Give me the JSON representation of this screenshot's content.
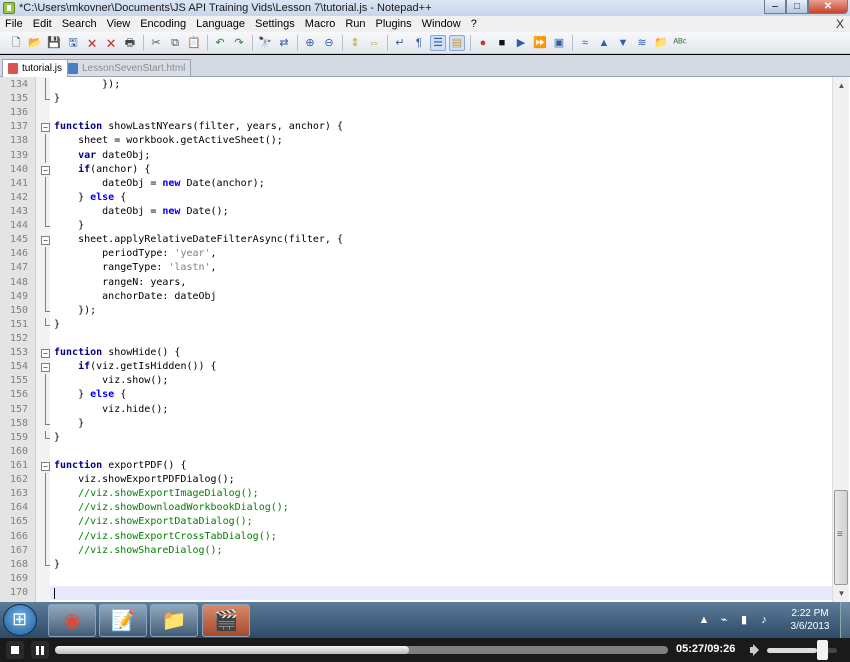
{
  "window": {
    "title": "*C:\\Users\\mkovner\\Documents\\JS API Training Vids\\Lesson 7\\tutorial.js - Notepad++",
    "minimize": "‒",
    "maximize": "□",
    "close": "✕"
  },
  "menu": [
    "File",
    "Edit",
    "Search",
    "View",
    "Encoding",
    "Language",
    "Settings",
    "Macro",
    "Run",
    "Plugins",
    "Window",
    "?"
  ],
  "menu_close": "X",
  "toolbar": [
    {
      "name": "new-file-icon",
      "glyph": "🗋",
      "color": "#333"
    },
    {
      "name": "open-file-icon",
      "glyph": "📂",
      "color": "#c89b2c"
    },
    {
      "name": "save-icon",
      "glyph": "💾",
      "color": "#2f5fa8"
    },
    {
      "name": "save-all-icon",
      "glyph": "🖫",
      "color": "#2f5fa8"
    },
    {
      "name": "close-file-icon",
      "glyph": "🗙",
      "color": "#c0392b"
    },
    {
      "name": "close-all-icon",
      "glyph": "🗙",
      "color": "#c0392b"
    },
    {
      "name": "print-icon",
      "glyph": "🖶",
      "color": "#444"
    },
    {
      "sep": true
    },
    {
      "name": "cut-icon",
      "glyph": "✂",
      "color": "#555"
    },
    {
      "name": "copy-icon",
      "glyph": "⧉",
      "color": "#555"
    },
    {
      "name": "paste-icon",
      "glyph": "📋",
      "color": "#a67c33"
    },
    {
      "sep": true
    },
    {
      "name": "undo-icon",
      "glyph": "↶",
      "color": "#2e7d32"
    },
    {
      "name": "redo-icon",
      "glyph": "↷",
      "color": "#2e7d32"
    },
    {
      "sep": true
    },
    {
      "name": "find-icon",
      "glyph": "🔭",
      "color": "#333"
    },
    {
      "name": "replace-icon",
      "glyph": "⇄",
      "color": "#2f5fa8"
    },
    {
      "sep": true
    },
    {
      "name": "zoom-in-icon",
      "glyph": "⊕",
      "color": "#2f5fa8"
    },
    {
      "name": "zoom-out-icon",
      "glyph": "⊖",
      "color": "#2f5fa8"
    },
    {
      "sep": true
    },
    {
      "name": "sync-vertical-icon",
      "glyph": "⇕",
      "color": "#c89b2c"
    },
    {
      "name": "sync-horizontal-icon",
      "glyph": "⇔",
      "color": "#c89b2c"
    },
    {
      "sep": true
    },
    {
      "name": "word-wrap-icon",
      "glyph": "↵",
      "color": "#2f5fa8"
    },
    {
      "name": "show-all-chars-icon",
      "glyph": "¶",
      "color": "#2f5fa8"
    },
    {
      "name": "indent-guide-icon",
      "glyph": "☰",
      "color": "#2f5fa8",
      "active": true
    },
    {
      "name": "folder-as-workspace-icon",
      "glyph": "▤",
      "color": "#c89b2c",
      "active": true
    },
    {
      "sep": true
    },
    {
      "name": "record-macro-icon",
      "glyph": "●",
      "color": "#c0392b"
    },
    {
      "name": "stop-macro-icon",
      "glyph": "■",
      "color": "#111"
    },
    {
      "name": "play-macro-icon",
      "glyph": "▶",
      "color": "#2f5fa8"
    },
    {
      "name": "play-macro-multiple-icon",
      "glyph": "⏩",
      "color": "#2f5fa8"
    },
    {
      "name": "save-macro-icon",
      "glyph": "▣",
      "color": "#2f5fa8"
    },
    {
      "sep": true
    },
    {
      "name": "collapse-icon",
      "glyph": "≈",
      "color": "#2f5fa8"
    },
    {
      "name": "move-up-icon",
      "glyph": "▲",
      "color": "#2f5fa8"
    },
    {
      "name": "move-down-icon",
      "glyph": "▼",
      "color": "#2f5fa8"
    },
    {
      "name": "expand-icon",
      "glyph": "≋",
      "color": "#2f5fa8"
    },
    {
      "name": "folder-icon",
      "glyph": "📁",
      "color": "#c89b2c"
    },
    {
      "name": "spellcheck-icon",
      "glyph": "ᴬᴮᶜ",
      "color": "#2e7d32"
    }
  ],
  "tabs": [
    {
      "label": "tutorial.js",
      "active": true,
      "icon_color": "#d9534f"
    },
    {
      "label": "LessonSevenStart.html",
      "active": false,
      "icon_color": "#4a7cc7"
    }
  ],
  "code_lines": [
    {
      "n": "134",
      "fold": "line",
      "tokens": [
        {
          "t": "        });",
          "c": "id"
        }
      ]
    },
    {
      "n": "135",
      "fold": "end",
      "tokens": [
        {
          "t": "}",
          "c": "id"
        }
      ]
    },
    {
      "n": "136",
      "fold": "",
      "tokens": []
    },
    {
      "n": "137",
      "fold": "box",
      "tokens": [
        {
          "t": "function",
          "c": "kw"
        },
        {
          "t": " showLastNYears(filter, years, anchor) {",
          "c": "id"
        }
      ]
    },
    {
      "n": "138",
      "fold": "line",
      "tokens": [
        {
          "t": "    sheet = workbook.getActiveSheet();",
          "c": "id"
        }
      ]
    },
    {
      "n": "139",
      "fold": "line",
      "tokens": [
        {
          "t": "    ",
          "c": "id"
        },
        {
          "t": "var",
          "c": "kw"
        },
        {
          "t": " dateObj;",
          "c": "id"
        }
      ]
    },
    {
      "n": "140",
      "fold": "box",
      "tokens": [
        {
          "t": "    ",
          "c": "id"
        },
        {
          "t": "if",
          "c": "kw"
        },
        {
          "t": "(anchor) {",
          "c": "id"
        }
      ]
    },
    {
      "n": "141",
      "fold": "line",
      "tokens": [
        {
          "t": "        dateObj = ",
          "c": "id"
        },
        {
          "t": "new",
          "c": "kw2"
        },
        {
          "t": " Date(anchor);",
          "c": "id"
        }
      ]
    },
    {
      "n": "142",
      "fold": "line",
      "tokens": [
        {
          "t": "    } ",
          "c": "id"
        },
        {
          "t": "else",
          "c": "kw2"
        },
        {
          "t": " {",
          "c": "id"
        }
      ]
    },
    {
      "n": "143",
      "fold": "line",
      "tokens": [
        {
          "t": "        dateObj = ",
          "c": "id"
        },
        {
          "t": "new",
          "c": "kw2"
        },
        {
          "t": " Date();",
          "c": "id"
        }
      ]
    },
    {
      "n": "144",
      "fold": "end",
      "tokens": [
        {
          "t": "    }",
          "c": "id"
        }
      ]
    },
    {
      "n": "145",
      "fold": "box",
      "tokens": [
        {
          "t": "    sheet.applyRelativeDateFilterAsync(filter, {",
          "c": "id"
        }
      ]
    },
    {
      "n": "146",
      "fold": "line",
      "tokens": [
        {
          "t": "        periodType: ",
          "c": "id"
        },
        {
          "t": "'year'",
          "c": "str"
        },
        {
          "t": ",",
          "c": "id"
        }
      ]
    },
    {
      "n": "147",
      "fold": "line",
      "tokens": [
        {
          "t": "        rangeType: ",
          "c": "id"
        },
        {
          "t": "'lastn'",
          "c": "str"
        },
        {
          "t": ",",
          "c": "id"
        }
      ]
    },
    {
      "n": "148",
      "fold": "line",
      "tokens": [
        {
          "t": "        rangeN: years,",
          "c": "id"
        }
      ]
    },
    {
      "n": "149",
      "fold": "line",
      "tokens": [
        {
          "t": "        anchorDate: dateObj",
          "c": "id"
        }
      ]
    },
    {
      "n": "150",
      "fold": "end",
      "tokens": [
        {
          "t": "    });",
          "c": "id"
        }
      ]
    },
    {
      "n": "151",
      "fold": "end",
      "tokens": [
        {
          "t": "}",
          "c": "id"
        }
      ]
    },
    {
      "n": "152",
      "fold": "",
      "tokens": []
    },
    {
      "n": "153",
      "fold": "box",
      "tokens": [
        {
          "t": "function",
          "c": "kw"
        },
        {
          "t": " showHide() {",
          "c": "id"
        }
      ]
    },
    {
      "n": "154",
      "fold": "box",
      "tokens": [
        {
          "t": "    ",
          "c": "id"
        },
        {
          "t": "if",
          "c": "kw"
        },
        {
          "t": "(viz.getIsHidden()) {",
          "c": "id"
        }
      ]
    },
    {
      "n": "155",
      "fold": "line",
      "tokens": [
        {
          "t": "        viz.show();",
          "c": "id"
        }
      ]
    },
    {
      "n": "156",
      "fold": "line",
      "tokens": [
        {
          "t": "    } ",
          "c": "id"
        },
        {
          "t": "else",
          "c": "kw2"
        },
        {
          "t": " {",
          "c": "id"
        }
      ]
    },
    {
      "n": "157",
      "fold": "line",
      "tokens": [
        {
          "t": "        viz.hide();",
          "c": "id"
        }
      ]
    },
    {
      "n": "158",
      "fold": "end",
      "tokens": [
        {
          "t": "    }",
          "c": "id"
        }
      ]
    },
    {
      "n": "159",
      "fold": "end",
      "tokens": [
        {
          "t": "}",
          "c": "id"
        }
      ]
    },
    {
      "n": "160",
      "fold": "",
      "tokens": []
    },
    {
      "n": "161",
      "fold": "box",
      "tokens": [
        {
          "t": "function",
          "c": "kw"
        },
        {
          "t": " exportPDF() {",
          "c": "id"
        }
      ]
    },
    {
      "n": "162",
      "fold": "line",
      "tokens": [
        {
          "t": "    viz.showExportPDFDialog();",
          "c": "id"
        }
      ]
    },
    {
      "n": "163",
      "fold": "line",
      "tokens": [
        {
          "t": "    //viz.showExportImageDialog();",
          "c": "cmt"
        }
      ]
    },
    {
      "n": "164",
      "fold": "line",
      "tokens": [
        {
          "t": "    //viz.showDownloadWorkbookDialog();",
          "c": "cmt"
        }
      ]
    },
    {
      "n": "165",
      "fold": "line",
      "tokens": [
        {
          "t": "    //viz.showExportDataDialog();",
          "c": "cmt"
        }
      ]
    },
    {
      "n": "166",
      "fold": "line",
      "tokens": [
        {
          "t": "    //viz.showExportCrossTabDialog();",
          "c": "cmt"
        }
      ]
    },
    {
      "n": "167",
      "fold": "line",
      "tokens": [
        {
          "t": "    //viz.showShareDialog();",
          "c": "cmt"
        }
      ]
    },
    {
      "n": "168",
      "fold": "end",
      "tokens": [
        {
          "t": "}",
          "c": "id"
        }
      ]
    },
    {
      "n": "169",
      "fold": "",
      "tokens": []
    },
    {
      "n": "170",
      "fold": "",
      "tokens": [],
      "current": true
    }
  ],
  "taskbar": {
    "apps": [
      {
        "name": "chrome-taskbar-icon",
        "glyph": "◉",
        "color": "#e04a3a",
        "active": false
      },
      {
        "name": "notepadpp-taskbar-icon",
        "glyph": "📝",
        "color": "#7cb342",
        "active": false
      },
      {
        "name": "explorer-taskbar-icon",
        "glyph": "📁",
        "color": "#e0b44a",
        "active": false
      },
      {
        "name": "recorder-taskbar-icon",
        "glyph": "🎬",
        "color": "#c44",
        "active": true
      }
    ],
    "clock_time": "2:22 PM",
    "clock_date": "3/6/2013"
  },
  "player": {
    "time": "05:27/09:26",
    "progress": 0.578,
    "volume": 0.72
  }
}
